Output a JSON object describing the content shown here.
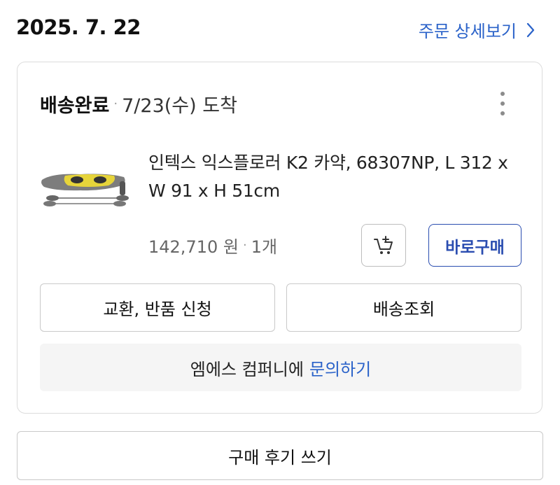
{
  "header": {
    "order_date": "2025. 7. 22",
    "detail_link_label": "주문 상세보기"
  },
  "order": {
    "status": "배송완료",
    "arrival_text": "7/23(수) 도착",
    "product_name": "인텍스 익스플로러 K2 카약, 68307NP, L 312 x W 91 x H 51cm",
    "price": "142,710 원",
    "quantity": "1개",
    "buy_now_label": "바로구매",
    "return_label": "교환, 반품 신청",
    "track_label": "배송조회",
    "inquiry_prefix": "엠에스 컴퍼니에",
    "inquiry_link": "문의하기"
  },
  "review_label": "구매 후기 쓰기",
  "icons": {
    "detail_arrow": "chevron-right-icon",
    "more": "more-vertical-icon",
    "cart": "add-to-cart-icon"
  },
  "colors": {
    "link_blue": "#2a62c9",
    "buy_blue": "#2a4db0",
    "kayak_yellow": "#e6d43a"
  }
}
